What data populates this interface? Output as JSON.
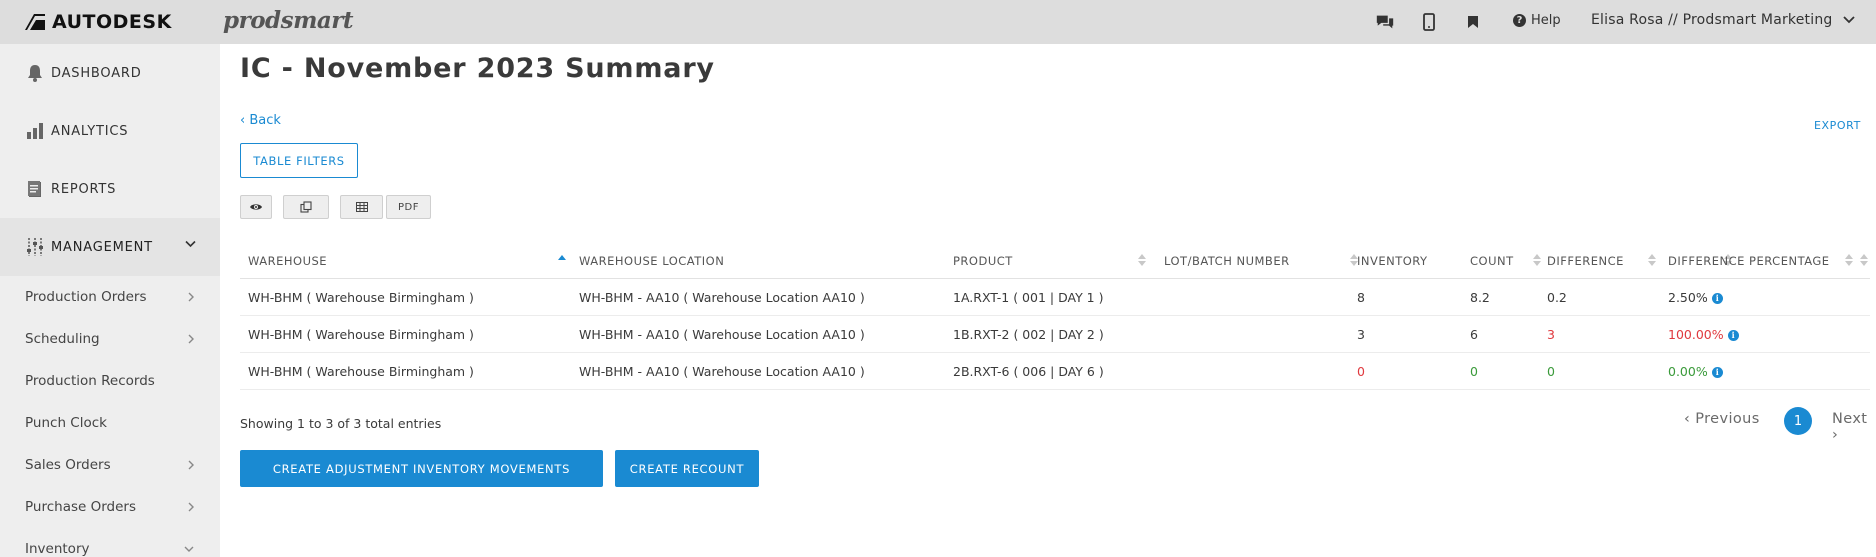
{
  "header": {
    "brand": "AUTODESK",
    "product": "prodsmart",
    "help_label": "Help",
    "user": "Elisa Rosa // Prodsmart Marketing",
    "icons": [
      "chat-icon",
      "mobile-icon",
      "bookmark-icon",
      "help-icon",
      "chevron-down-icon"
    ]
  },
  "sidebar": {
    "top_items": [
      {
        "label": "DASHBOARD",
        "icon": "bell-icon"
      },
      {
        "label": "ANALYTICS",
        "icon": "bar-chart-icon"
      },
      {
        "label": "REPORTS",
        "icon": "document-icon"
      },
      {
        "label": "MANAGEMENT",
        "icon": "sliders-icon"
      }
    ],
    "sub_items": [
      {
        "label": "Production Orders",
        "has_chevron": true
      },
      {
        "label": "Scheduling",
        "has_chevron": true
      },
      {
        "label": "Production Records",
        "has_chevron": false
      },
      {
        "label": "Punch Clock",
        "has_chevron": false
      },
      {
        "label": "Sales Orders",
        "has_chevron": true
      },
      {
        "label": "Purchase Orders",
        "has_chevron": true
      },
      {
        "label": "Inventory",
        "has_chevron": true
      }
    ]
  },
  "main": {
    "title": "IC - November 2023 Summary",
    "back_label": "Back",
    "export_label": "EXPORT",
    "filters_label": "TABLE FILTERS",
    "tool_buttons": [
      "eye-icon",
      "copy-icon",
      "table-icon",
      "PDF"
    ],
    "pdf_label": "PDF"
  },
  "table": {
    "columns": [
      "WAREHOUSE",
      "WAREHOUSE LOCATION",
      "PRODUCT",
      "LOT/BATCH NUMBER",
      "INVENTORY",
      "COUNT",
      "DIFFERENCE",
      "DIFFERENCE PERCENTAGE"
    ],
    "sorted_column": "WAREHOUSE",
    "sort_direction": "ascending",
    "rows": [
      {
        "warehouse": "WH-BHM ( Warehouse Birmingham )",
        "location": "WH-BHM - AA10 ( Warehouse Location AA10 )",
        "product": "1A.RXT-1 ( 001 | DAY 1 )",
        "lot": "",
        "inventory": "8",
        "count": "8.2",
        "difference": "0.2",
        "percentage": "2.50%",
        "status": "neutral"
      },
      {
        "warehouse": "WH-BHM ( Warehouse Birmingham )",
        "location": "WH-BHM - AA10 ( Warehouse Location AA10 )",
        "product": "1B.RXT-2 ( 002 | DAY 2 )",
        "lot": "",
        "inventory": "3",
        "count": "6",
        "difference": "3",
        "percentage": "100.00%",
        "status": "red"
      },
      {
        "warehouse": "WH-BHM ( Warehouse Birmingham )",
        "location": "WH-BHM - AA10 ( Warehouse Location AA10 )",
        "product": "2B.RXT-6 ( 006 | DAY 6 )",
        "lot": "",
        "inventory": "0",
        "count": "0",
        "difference": "0",
        "percentage": "0.00%",
        "status": "green"
      }
    ],
    "entries_text": "Showing 1 to 3 of 3 total entries"
  },
  "pagination": {
    "previous_label": "Previous",
    "current_page": "1",
    "next_label": "Next"
  },
  "actions": {
    "adjust_label": "CREATE ADJUSTMENT INVENTORY MOVEMENTS",
    "recount_label": "CREATE RECOUNT"
  },
  "colors": {
    "accent": "#1a8ad2",
    "negative": "#e0393e",
    "positive": "#3a9a3a",
    "topbar": "#dddddd",
    "sidebar": "#eeeeee"
  }
}
